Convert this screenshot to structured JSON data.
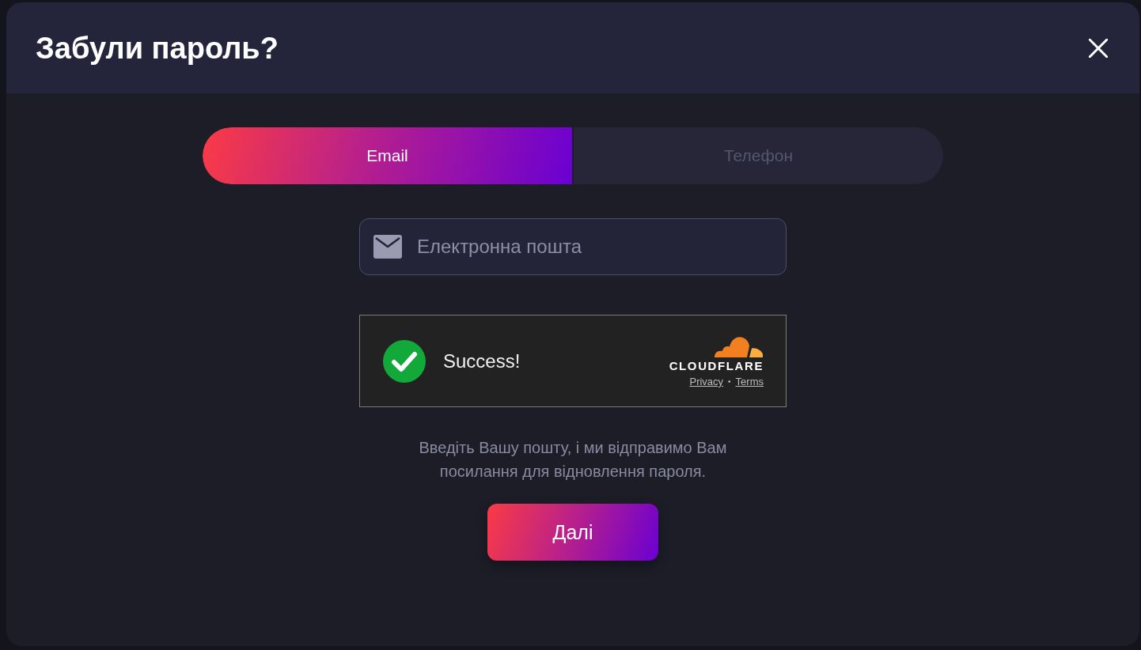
{
  "dialog": {
    "title": "Забули пароль?"
  },
  "tabs": [
    {
      "label": "Email",
      "selected": true
    },
    {
      "label": "Телефон",
      "selected": false
    }
  ],
  "email_field": {
    "placeholder": "Електронна пошта"
  },
  "captcha": {
    "verified": true,
    "status": "Success!",
    "brand": "CLOUDFLARE",
    "links": [
      "Privacy",
      "Terms"
    ],
    "separator": "•"
  },
  "hint": "Введіть Вашу пошту, і ми відправимо Вам посилання для відновлення пароля.",
  "submit_button": "Далі"
}
